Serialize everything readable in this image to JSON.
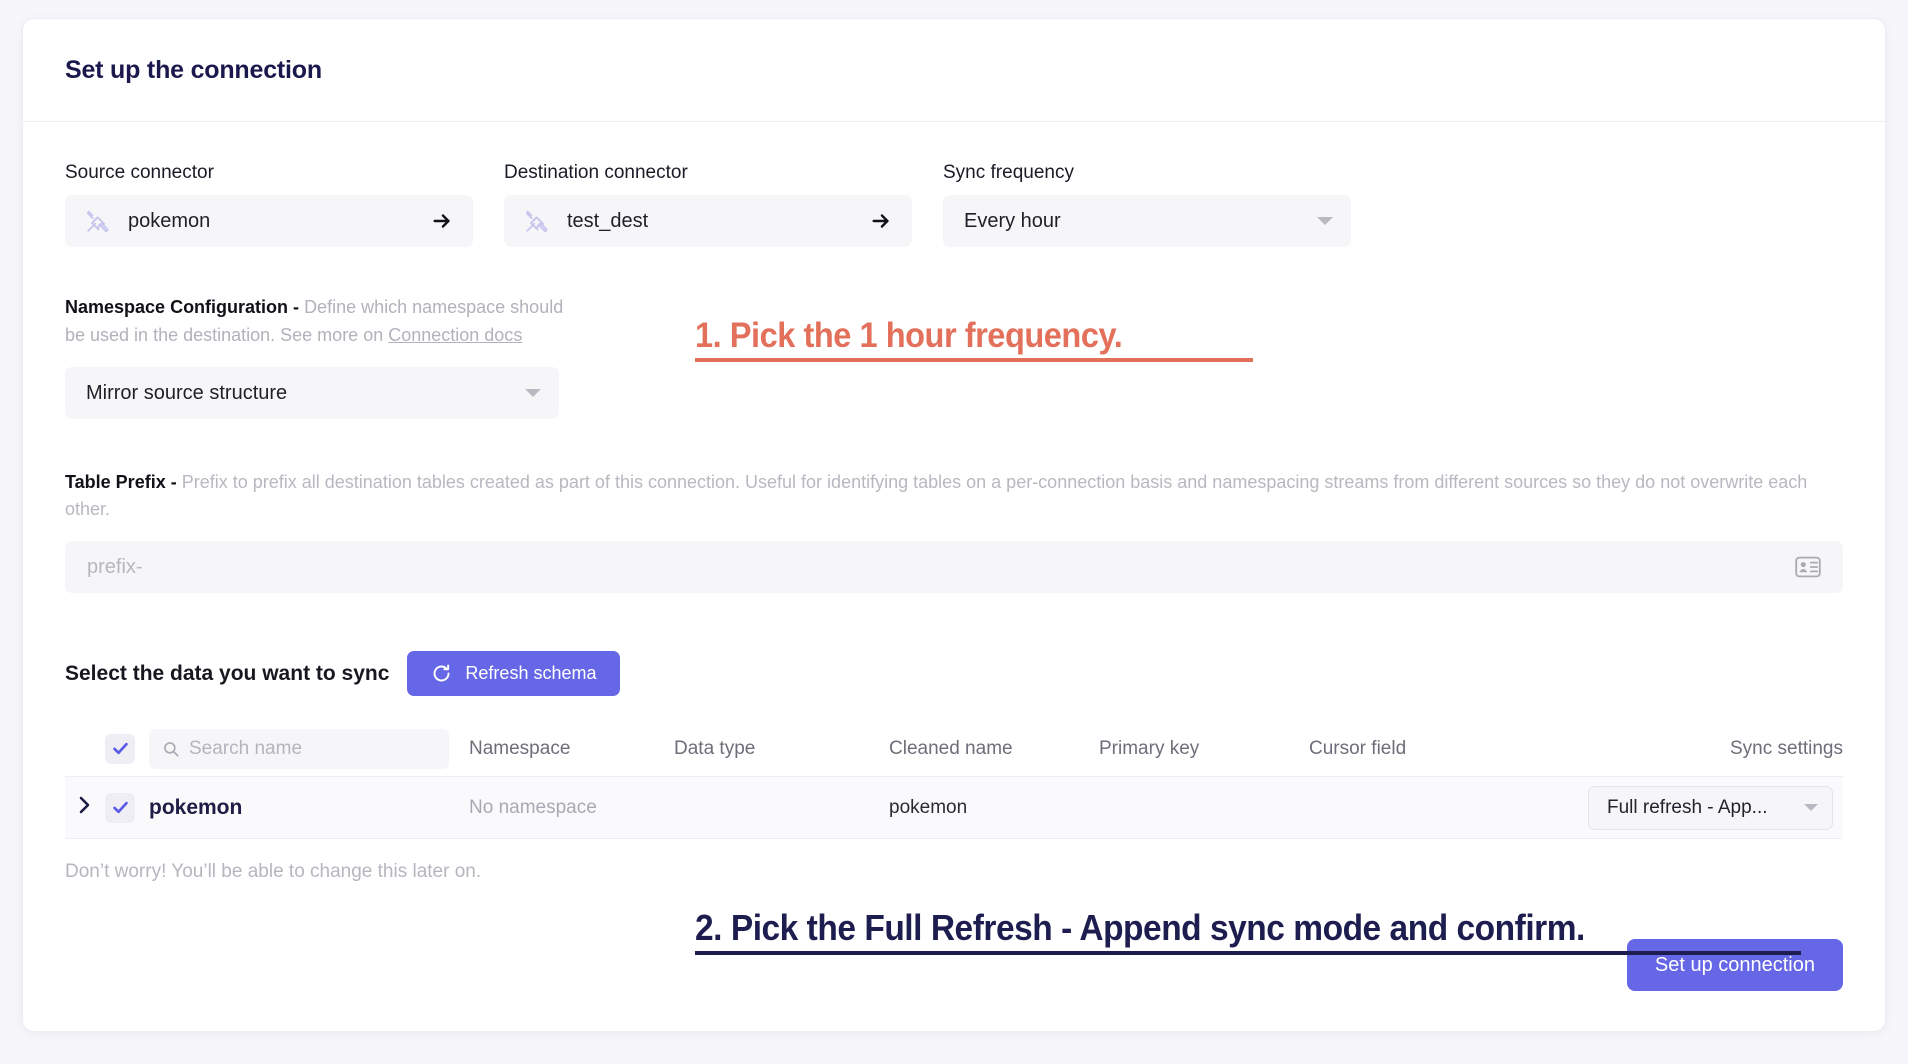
{
  "header": {
    "title": "Set up the connection"
  },
  "source": {
    "label": "Source connector",
    "name": "pokemon",
    "icon": "tools-icon",
    "arrow_icon": "arrow-right-icon"
  },
  "destination": {
    "label": "Destination connector",
    "name": "test_dest",
    "icon": "tools-icon",
    "arrow_icon": "arrow-right-icon"
  },
  "sync_frequency": {
    "label": "Sync frequency",
    "value": "Every hour",
    "caret_icon": "chevron-down-icon"
  },
  "namespace": {
    "title": "Namespace Configuration -",
    "description": "Define which namespace should be used in the destination. See more on",
    "link_text": "Connection docs",
    "value": "Mirror source structure",
    "caret_icon": "chevron-down-icon"
  },
  "table_prefix": {
    "title": "Table Prefix -",
    "description": "Prefix to prefix all destination tables created as part of this connection. Useful for identifying tables on a per-connection basis and namespacing streams from different sources so they do not overwrite each other.",
    "placeholder": "prefix-",
    "value": "",
    "trailing_icon": "contact-card-icon"
  },
  "sync_section": {
    "title": "Select the data you want to sync",
    "refresh_label": "Refresh schema",
    "refresh_icon": "refresh-icon",
    "footnote": "Don’t worry! You’ll be able to change this later on."
  },
  "schema_table": {
    "search_placeholder": "Search name",
    "search_value": "",
    "search_icon": "search-icon",
    "header_checked": true,
    "columns": [
      "Namespace",
      "Data type",
      "Cleaned name",
      "Primary key",
      "Cursor field",
      "Sync settings"
    ],
    "rows": [
      {
        "expand_icon": "chevron-right-icon",
        "checked": true,
        "name": "pokemon",
        "namespace": "No namespace",
        "data_type": "",
        "cleaned_name": "pokemon",
        "primary_key": "",
        "cursor_field": "",
        "sync_mode": "Full refresh - App...",
        "sync_mode_caret": "chevron-down-icon"
      }
    ]
  },
  "footer": {
    "submit_label": "Set up connection"
  },
  "annotations": [
    {
      "text": "1. Pick the 1 hour frequency.",
      "color": "#e2705a"
    },
    {
      "text": "2. Pick the Full Refresh - Append sync mode and confirm.",
      "color": "#1d1d4f"
    }
  ]
}
